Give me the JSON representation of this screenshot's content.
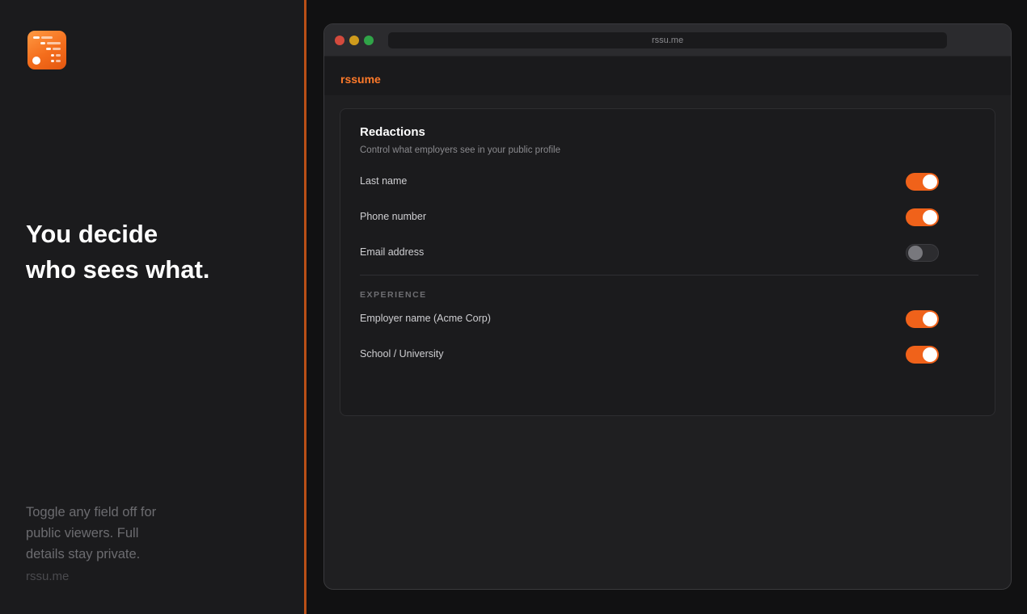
{
  "promo": {
    "headline_line1": "You decide",
    "headline_line2": "who sees what.",
    "description": "Toggle any field off for public viewers. Full details stay private.",
    "domain": "rssu.me"
  },
  "browser": {
    "url": "rssu.me"
  },
  "app": {
    "brand": "rssume",
    "accent_color": "#f0621a"
  },
  "redactions": {
    "title": "Redactions",
    "subtitle": "Control what employers see in your public profile",
    "fields": [
      {
        "label": "Last name",
        "enabled": true
      },
      {
        "label": "Phone number",
        "enabled": true
      },
      {
        "label": "Email address",
        "enabled": false
      }
    ],
    "experience_section": {
      "label": "EXPERIENCE",
      "fields": [
        {
          "label": "Employer name (Acme Corp)",
          "enabled": true
        },
        {
          "label": "School / University",
          "enabled": true
        }
      ]
    }
  }
}
